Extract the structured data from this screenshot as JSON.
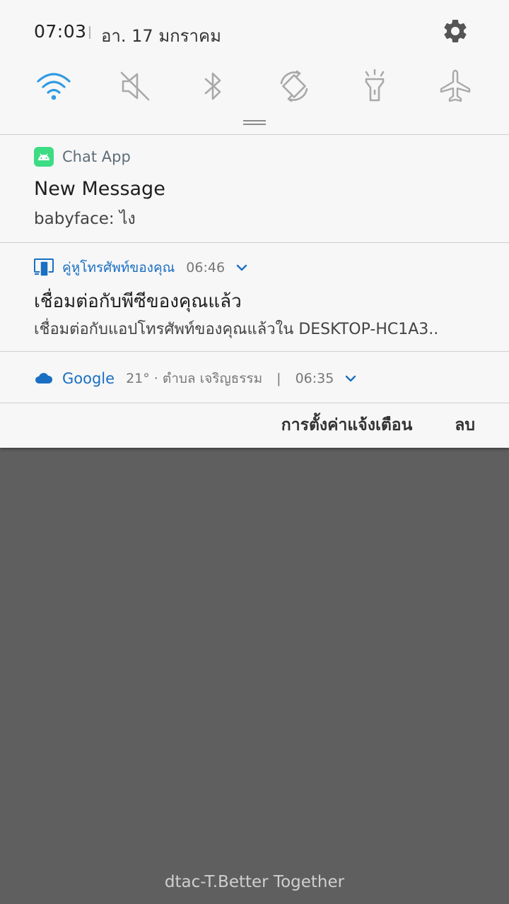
{
  "status": {
    "time": "07:03",
    "date": "อา. 17 มกราคม"
  },
  "quick_toggles": [
    {
      "name": "wifi",
      "active": true
    },
    {
      "name": "sound",
      "active": false
    },
    {
      "name": "bluetooth",
      "active": false
    },
    {
      "name": "auto-rotate",
      "active": false
    },
    {
      "name": "flashlight",
      "active": false
    },
    {
      "name": "airplane",
      "active": false
    }
  ],
  "notifications": {
    "chat": {
      "app_name": "Chat App",
      "title": "New Message",
      "text": "babyface: ไง"
    },
    "phone_companion": {
      "app_name": "คู่หูโทรศัพท์ของคุณ",
      "time": "06:46",
      "title": "เชื่อมต่อกับพีซีของคุณแล้ว",
      "text": "เชื่อมต่อกับแอปโทรศัพท์ของคุณแล้วใน DESKTOP-HC1A3.."
    },
    "google": {
      "app_name": "Google",
      "weather": "21° · ตำบล เจริญธรรม",
      "separator": "|",
      "time": "06:35"
    }
  },
  "actions": {
    "settings_label": "การตั้งค่าแจ้งเตือน",
    "clear_label": "ลบ"
  },
  "carrier": "dtac-T.Better Together",
  "colors": {
    "accent_blue": "#1a6fc2",
    "wifi_blue": "#2f9be3",
    "android_green": "#3ddc84",
    "panel_bg": "#f7f7f7",
    "backdrop": "#5f5f5f"
  }
}
